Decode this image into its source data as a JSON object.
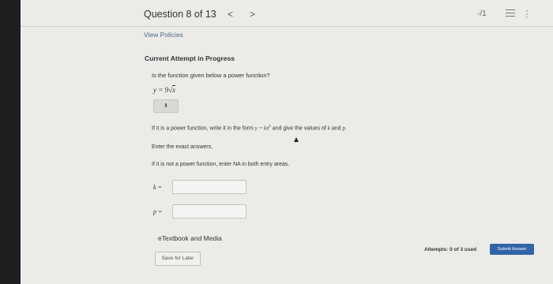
{
  "header": {
    "question_title": "Question 8 of 13",
    "prev_glyph": "<",
    "next_glyph": ">",
    "score": "-/1",
    "list_icon": "list-icon",
    "more_icon": "kebab-icon"
  },
  "links": {
    "view_policies": "View Policies"
  },
  "attempt": {
    "heading": "Current Attempt in Progress",
    "question": "Is the function given below a power function?",
    "formula_lhs": "y",
    "formula_eq": " = 9",
    "formula_rad": "√",
    "formula_arg": "x",
    "dropdown_value": "⬍"
  },
  "instructions": {
    "line1_pre": "If it is a power function, write it in the form ",
    "line1_form": "y = kx",
    "line1_exp": "p",
    "line1_post": " and give the values of ",
    "line1_k": "k",
    "line1_and": " and ",
    "line1_p": "p",
    "line1_end": ".",
    "line2": "Enter the exact answers.",
    "line3": "If it is not a power function, enter NA in both entry areas."
  },
  "fields": {
    "k_label": "k =",
    "k_value": "",
    "p_label": "p =",
    "p_value": ""
  },
  "footer": {
    "etextbook": "eTextbook and Media",
    "save_label": "Save for Later",
    "attempts": "Attempts: 0 of 3 used",
    "submit_label": "Submit Answer"
  },
  "colors": {
    "accent": "#2f65a6",
    "page_bg": "#ecebe8",
    "frame_bg": "#1f1f22"
  }
}
